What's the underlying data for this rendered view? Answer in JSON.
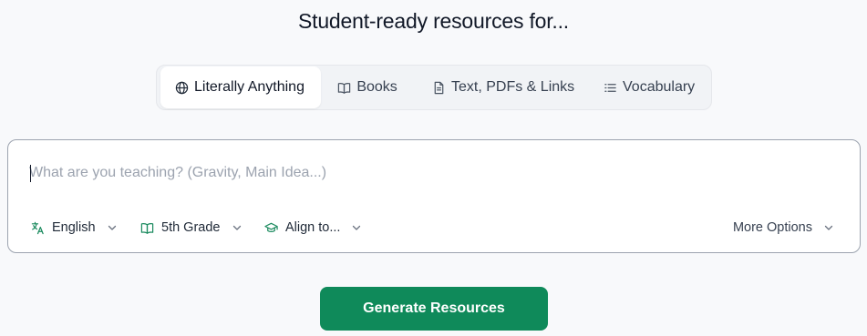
{
  "heading": "Student-ready resources for...",
  "tabs": [
    {
      "label": "Literally Anything",
      "icon": "globe-icon",
      "active": true
    },
    {
      "label": "Books",
      "icon": "book-open-icon",
      "active": false
    },
    {
      "label": "Text, PDFs & Links",
      "icon": "document-icon",
      "active": false
    },
    {
      "label": "Vocabulary",
      "icon": "list-icon",
      "active": false
    }
  ],
  "prompt": {
    "value": "",
    "placeholder": "What are you teaching? (Gravity, Main Idea...)"
  },
  "options": {
    "language": {
      "label": "English",
      "icon": "translate-icon"
    },
    "grade": {
      "label": "5th Grade",
      "icon": "book-open-icon"
    },
    "align": {
      "label": "Align to...",
      "icon": "graduation-cap-icon"
    },
    "more": {
      "label": "More Options",
      "icon": "chevron-down-icon"
    }
  },
  "generate_label": "Generate Resources",
  "colors": {
    "accent": "#0f8a5a",
    "icon_green": "#1a8a5e"
  }
}
